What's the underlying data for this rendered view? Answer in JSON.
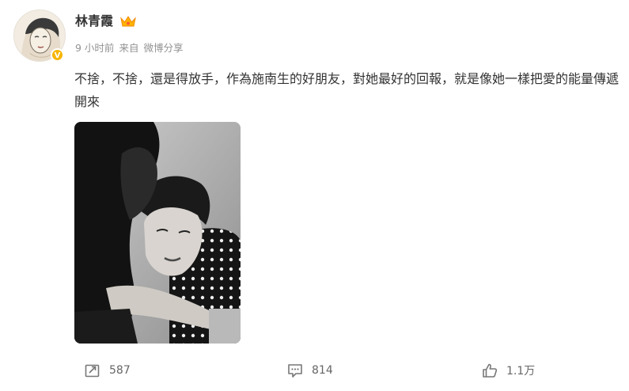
{
  "post": {
    "author_name": "林青霞",
    "meta": {
      "time": "9 小时前",
      "source_prefix": "来自",
      "source": "微博分享"
    },
    "text": "不捨，不捨，還是得放手，作為施南生的好朋友，對她最好的回報，就是像她一樣把愛的能量傳遞開來",
    "icons": {
      "avatar": "avatar-illustration",
      "verified": "verified-badge-icon",
      "member": "crown-icon",
      "photo": "bw-photo-two-women"
    }
  },
  "actions": {
    "repost": {
      "icon": "repost-icon",
      "count": "587"
    },
    "comment": {
      "icon": "comment-icon",
      "count": "814"
    },
    "like": {
      "icon": "like-icon",
      "count": "1.1万"
    }
  },
  "colors": {
    "verified": "#f7b500",
    "meta_text": "#939393",
    "text": "#333333",
    "action_text": "#666666"
  }
}
